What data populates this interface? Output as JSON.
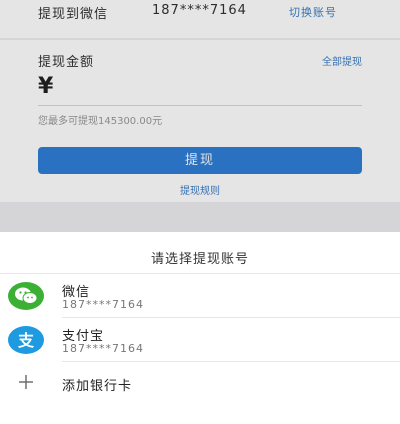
{
  "header": {
    "label": "提现到微信",
    "account": "187****7164",
    "switch_label": "切换账号"
  },
  "amount": {
    "title": "提现金额",
    "withdraw_all": "全部提现",
    "currency": "¥",
    "max_hint": "您最多可提现145300.00元"
  },
  "actions": {
    "withdraw_label": "提现",
    "rules_label": "提现规则"
  },
  "sheet": {
    "title": "请选择提现账号",
    "options": [
      {
        "name": "微信",
        "account": "187****7164",
        "icon": "wechat-icon"
      },
      {
        "name": "支付宝",
        "account": "187****7164",
        "icon": "alipay-icon"
      },
      {
        "name": "添加银行卡",
        "icon": "plus-icon"
      }
    ]
  },
  "colors": {
    "accent": "#2f7ed8",
    "link": "#3d7fc6",
    "wechat": "#3cb034",
    "alipay": "#1e9ae0"
  }
}
